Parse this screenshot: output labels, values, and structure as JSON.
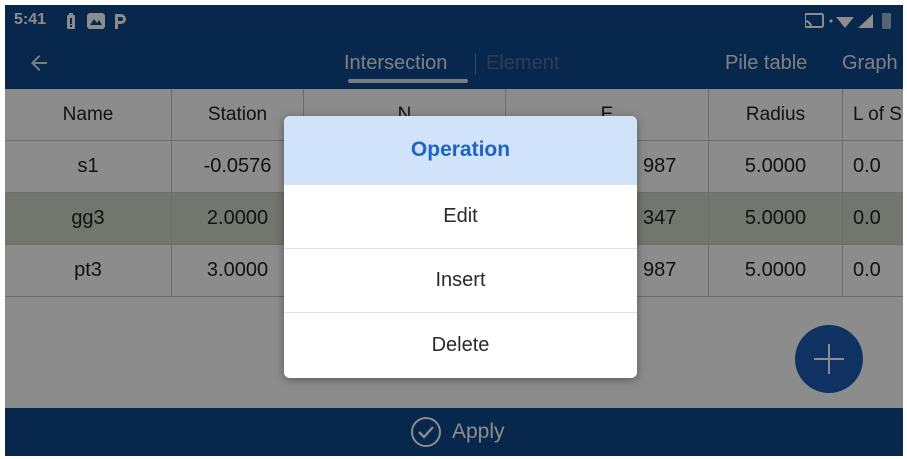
{
  "status_bar": {
    "time": "5:41",
    "icons": [
      "battery-alert-icon",
      "photos-icon",
      "parking-icon",
      "cast-icon",
      "wifi-icon",
      "signal-icon",
      "battery-icon"
    ]
  },
  "toolbar": {
    "tabs": [
      {
        "label": "Intersection",
        "selected": true
      },
      {
        "label": "Element",
        "selected": false
      }
    ],
    "pile_table_label": "Pile table",
    "graph_label": "Graph"
  },
  "table": {
    "headers": [
      "Name",
      "Station",
      "N",
      "E",
      "Radius",
      "L of S"
    ],
    "rows": [
      {
        "name": "s1",
        "station": "-0.0576",
        "e": "987",
        "radius": "5.0000",
        "los": "0.0"
      },
      {
        "name": "gg3",
        "station": "2.0000",
        "e": "347",
        "radius": "5.0000",
        "los": "0.0"
      },
      {
        "name": "pt3",
        "station": "3.0000",
        "e": "987",
        "radius": "5.0000",
        "los": "0.0"
      }
    ],
    "selected_row": 1
  },
  "apply_label": "Apply",
  "dialog": {
    "title": "Operation",
    "items": [
      "Edit",
      "Insert",
      "Delete"
    ]
  },
  "colors": {
    "primary": "#10478c",
    "fab": "#1d5bb5",
    "dialog_title_bg": "#d0e3fa",
    "dialog_title_text": "#1f64c4",
    "selected_row": "#cfd8c9"
  }
}
